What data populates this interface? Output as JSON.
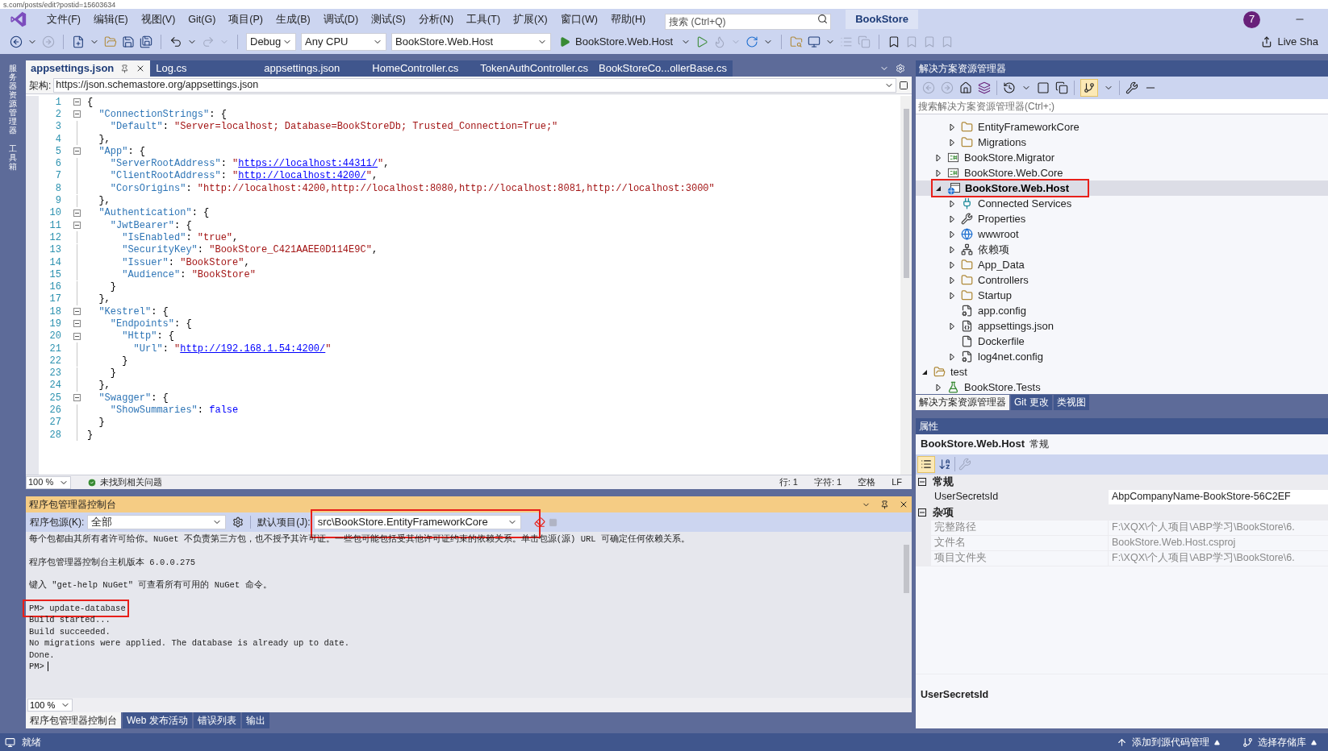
{
  "browser_url": "s.com/posts/edit?postid=15603634",
  "menu": [
    "文件(F)",
    "编辑(E)",
    "视图(V)",
    "Git(G)",
    "项目(P)",
    "生成(B)",
    "调试(D)",
    "测试(S)",
    "分析(N)",
    "工具(T)",
    "扩展(X)",
    "窗口(W)",
    "帮助(H)"
  ],
  "search": {
    "placeholder": "搜索 (Ctrl+Q)"
  },
  "solution_name": "BookStore",
  "account_badge": "7",
  "toolbar": {
    "configuration": "Debug",
    "platform": "Any CPU",
    "startup_project": "BookStore.Web.Host",
    "run_label": "BookStore.Web.Host",
    "live_share": "Live Sha"
  },
  "side_strip": [
    "服务器资源管理器",
    "工具箱"
  ],
  "doc_tabs": [
    {
      "label": "appsettings.json",
      "selected": true
    },
    {
      "label": "Log.cs",
      "selected": false
    },
    {
      "label": "appsettings.json",
      "selected": false
    },
    {
      "label": "HomeController.cs",
      "selected": false
    },
    {
      "label": "TokenAuthController.cs",
      "selected": false
    },
    {
      "label": "BookStoreCo...ollerBase.cs",
      "selected": false
    }
  ],
  "schema": {
    "label": "架构:",
    "value": "https://json.schemastore.org/appsettings.json"
  },
  "code_lines": [
    {
      "number": "1",
      "fold": true,
      "segments": [
        {
          "kind": "p",
          "text": "{"
        }
      ]
    },
    {
      "number": "2",
      "fold": true,
      "segments": [
        {
          "kind": "k",
          "text": "  \"ConnectionStrings\""
        },
        {
          "kind": "p",
          "text": ": {"
        }
      ]
    },
    {
      "number": "3",
      "fold": false,
      "segments": [
        {
          "kind": "k",
          "text": "    \"Default\""
        },
        {
          "kind": "p",
          "text": ": "
        },
        {
          "kind": "s",
          "text": "\"Server=localhost; Database=BookStoreDb; Trusted_Connection=True;\""
        }
      ]
    },
    {
      "number": "4",
      "fold": false,
      "segments": [
        {
          "kind": "p",
          "text": "  },"
        }
      ]
    },
    {
      "number": "5",
      "fold": true,
      "segments": [
        {
          "kind": "k",
          "text": "  \"App\""
        },
        {
          "kind": "p",
          "text": ": {"
        }
      ]
    },
    {
      "number": "6",
      "fold": false,
      "segments": [
        {
          "kind": "k",
          "text": "    \"ServerRootAddress\""
        },
        {
          "kind": "p",
          "text": ": "
        },
        {
          "kind": "s",
          "text": "\""
        },
        {
          "kind": "u",
          "text": "https://localhost:44311/"
        },
        {
          "kind": "s",
          "text": "\""
        },
        {
          "kind": "p",
          "text": ","
        }
      ]
    },
    {
      "number": "7",
      "fold": false,
      "segments": [
        {
          "kind": "k",
          "text": "    \"ClientRootAddress\""
        },
        {
          "kind": "p",
          "text": ": "
        },
        {
          "kind": "s",
          "text": "\""
        },
        {
          "kind": "u",
          "text": "http://localhost:4200/"
        },
        {
          "kind": "s",
          "text": "\""
        },
        {
          "kind": "p",
          "text": ","
        }
      ]
    },
    {
      "number": "8",
      "fold": false,
      "segments": [
        {
          "kind": "k",
          "text": "    \"CorsOrigins\""
        },
        {
          "kind": "p",
          "text": ": "
        },
        {
          "kind": "s",
          "text": "\"http://localhost:4200,http://localhost:8080,http://localhost:8081,http://localhost:3000\""
        }
      ]
    },
    {
      "number": "9",
      "fold": false,
      "segments": [
        {
          "kind": "p",
          "text": "  },"
        }
      ]
    },
    {
      "number": "10",
      "fold": true,
      "segments": [
        {
          "kind": "k",
          "text": "  \"Authentication\""
        },
        {
          "kind": "p",
          "text": ": {"
        }
      ]
    },
    {
      "number": "11",
      "fold": true,
      "segments": [
        {
          "kind": "k",
          "text": "    \"JwtBearer\""
        },
        {
          "kind": "p",
          "text": ": {"
        }
      ]
    },
    {
      "number": "12",
      "fold": false,
      "segments": [
        {
          "kind": "k",
          "text": "      \"IsEnabled\""
        },
        {
          "kind": "p",
          "text": ": "
        },
        {
          "kind": "s",
          "text": "\"true\""
        },
        {
          "kind": "p",
          "text": ","
        }
      ]
    },
    {
      "number": "13",
      "fold": false,
      "segments": [
        {
          "kind": "k",
          "text": "      \"SecurityKey\""
        },
        {
          "kind": "p",
          "text": ": "
        },
        {
          "kind": "s",
          "text": "\"BookStore_C421AAEE0D114E9C\""
        },
        {
          "kind": "p",
          "text": ","
        }
      ]
    },
    {
      "number": "14",
      "fold": false,
      "segments": [
        {
          "kind": "k",
          "text": "      \"Issuer\""
        },
        {
          "kind": "p",
          "text": ": "
        },
        {
          "kind": "s",
          "text": "\"BookStore\""
        },
        {
          "kind": "p",
          "text": ","
        }
      ]
    },
    {
      "number": "15",
      "fold": false,
      "segments": [
        {
          "kind": "k",
          "text": "      \"Audience\""
        },
        {
          "kind": "p",
          "text": ": "
        },
        {
          "kind": "s",
          "text": "\"BookStore\""
        }
      ]
    },
    {
      "number": "16",
      "fold": false,
      "segments": [
        {
          "kind": "p",
          "text": "    }"
        }
      ]
    },
    {
      "number": "17",
      "fold": false,
      "segments": [
        {
          "kind": "p",
          "text": "  },"
        }
      ]
    },
    {
      "number": "18",
      "fold": true,
      "segments": [
        {
          "kind": "k",
          "text": "  \"Kestrel\""
        },
        {
          "kind": "p",
          "text": ": {"
        }
      ]
    },
    {
      "number": "19",
      "fold": true,
      "segments": [
        {
          "kind": "k",
          "text": "    \"Endpoints\""
        },
        {
          "kind": "p",
          "text": ": {"
        }
      ]
    },
    {
      "number": "20",
      "fold": true,
      "segments": [
        {
          "kind": "k",
          "text": "      \"Http\""
        },
        {
          "kind": "p",
          "text": ": {"
        }
      ]
    },
    {
      "number": "21",
      "fold": false,
      "segments": [
        {
          "kind": "k",
          "text": "        \"Url\""
        },
        {
          "kind": "p",
          "text": ": "
        },
        {
          "kind": "s",
          "text": "\""
        },
        {
          "kind": "u",
          "text": "http://192.168.1.54:4200/"
        },
        {
          "kind": "s",
          "text": "\""
        }
      ]
    },
    {
      "number": "22",
      "fold": false,
      "segments": [
        {
          "kind": "p",
          "text": "      }"
        }
      ]
    },
    {
      "number": "23",
      "fold": false,
      "segments": [
        {
          "kind": "p",
          "text": "    }"
        }
      ]
    },
    {
      "number": "24",
      "fold": false,
      "segments": [
        {
          "kind": "p",
          "text": "  },"
        }
      ]
    },
    {
      "number": "25",
      "fold": true,
      "segments": [
        {
          "kind": "k",
          "text": "  \"Swagger\""
        },
        {
          "kind": "p",
          "text": ": {"
        }
      ]
    },
    {
      "number": "26",
      "fold": false,
      "segments": [
        {
          "kind": "k",
          "text": "    \"ShowSummaries\""
        },
        {
          "kind": "p",
          "text": ": "
        },
        {
          "kind": "b",
          "text": "false"
        }
      ]
    },
    {
      "number": "27",
      "fold": false,
      "segments": [
        {
          "kind": "p",
          "text": "  }"
        }
      ]
    },
    {
      "number": "28",
      "fold": false,
      "segments": [
        {
          "kind": "p",
          "text": "}"
        }
      ]
    }
  ],
  "editor_status": {
    "zoom": "100 %",
    "issues": "未找到相关问题",
    "line": "行: 1",
    "char": "字符: 1",
    "indent": "空格",
    "eol": "LF"
  },
  "console": {
    "title": "程序包管理器控制台",
    "source_label": "程序包源(K):",
    "source": "全部",
    "project_label": "默认项目(J):",
    "project": "src\\BookStore.EntityFrameworkCore",
    "project_annotated": true,
    "lines": [
      {
        "kind": "message",
        "text": "每个包都由其所有者许可给你。NuGet 不负责第三方包，也不授予其许可证。一些包可能包括受其他许可证约束的依赖关系。单击包源(源) URL 可确定任何依赖关系。",
        "annotated": false
      },
      {
        "kind": "message",
        "text": "程序包管理器控制台主机版本 6.0.0.275",
        "annotated": false
      },
      {
        "kind": "message",
        "text": "键入 \"get-help NuGet\" 可查看所有可用的 NuGet 命令。",
        "annotated": false
      },
      {
        "kind": "command",
        "text": "PM> update-database",
        "annotated": true
      },
      {
        "kind": "output",
        "text": "Build started...",
        "annotated": false
      },
      {
        "kind": "output",
        "text": "Build succeeded.",
        "annotated": false
      },
      {
        "kind": "output",
        "text": "No migrations were applied. The database is already up to date.",
        "annotated": false
      },
      {
        "kind": "output",
        "text": "Done.",
        "annotated": false
      },
      {
        "kind": "prompt",
        "text": "PM>",
        "annotated": false
      }
    ],
    "zoom": "100 %"
  },
  "bottom_tabs": [
    {
      "label": "程序包管理器控制台",
      "selected": true
    },
    {
      "label": "Web 发布活动",
      "selected": false
    },
    {
      "label": "错误列表",
      "selected": false
    },
    {
      "label": "输出",
      "selected": false
    }
  ],
  "solution_explorer": {
    "title": "解决方案资源管理器",
    "search_placeholder": "搜索解决方案资源管理器(Ctrl+;)",
    "tree": [
      {
        "children": [
          {
            "children": [
              {
                "label": "EntityFrameworkCore",
                "kind": "folder",
                "expanded": false,
                "selected": false
              },
              {
                "label": "Migrations",
                "kind": "folder",
                "expanded": false,
                "selected": false
              }
            ]
          },
          {
            "label": "BookStore.Migrator",
            "kind": "csharp",
            "expanded": false,
            "selected": false
          },
          {
            "label": "BookStore.Web.Core",
            "kind": "csharp",
            "expanded": false,
            "selected": false
          },
          {
            "label": "BookStore.Web.Host",
            "kind": "web_project",
            "expanded": true,
            "selected": true,
            "annotated": true,
            "children": [
              {
                "label": "Connected Services",
                "kind": "connected",
                "expanded": false,
                "selected": false
              },
              {
                "label": "Properties",
                "kind": "properties",
                "expanded": false,
                "selected": false
              },
              {
                "label": "wwwroot",
                "kind": "globe",
                "expanded": false,
                "selected": false
              },
              {
                "label": "依赖项",
                "kind": "dependencies",
                "expanded": false,
                "selected": false
              },
              {
                "label": "App_Data",
                "kind": "folder",
                "expanded": false,
                "selected": false
              },
              {
                "label": "Controllers",
                "kind": "folder",
                "expanded": false,
                "selected": false
              },
              {
                "label": "Startup",
                "kind": "folder",
                "expanded": false,
                "selected": false
              },
              {
                "label": "app.config",
                "kind": "config",
                "selected": false
              },
              {
                "label": "appsettings.json",
                "kind": "json",
                "expanded": false,
                "selected": false
              },
              {
                "label": "Dockerfile",
                "kind": "file",
                "selected": false
              },
              {
                "label": "log4net.config",
                "kind": "config",
                "expanded": false,
                "selected": false
              }
            ]
          }
        ]
      },
      {
        "label": "test",
        "kind": "folder_open",
        "expanded": true,
        "selected": false,
        "children": [
          {
            "label": "BookStore.Tests",
            "kind": "test_project",
            "expanded": false,
            "selected": false
          }
        ]
      }
    ],
    "tabs": [
      {
        "label": "解决方案资源管理器",
        "selected": true
      },
      {
        "label": "Git 更改",
        "selected": false
      },
      {
        "label": "类视图",
        "selected": false
      }
    ]
  },
  "properties": {
    "title": "属性",
    "object": "BookStore.Web.Host",
    "object_type": "常规",
    "categories": [
      {
        "name": "常规",
        "expanded": true,
        "rows": [
          {
            "name": "UserSecretsId",
            "value": "AbpCompanyName-BookStore-56C2EF",
            "disabled": false
          }
        ]
      },
      {
        "name": "杂项",
        "expanded": true,
        "rows": [
          {
            "name": "完整路径",
            "value": "F:\\XQX\\个人项目\\ABP学习\\BookStore\\6.",
            "disabled": true
          },
          {
            "name": "文件名",
            "value": "BookStore.Web.Host.csproj",
            "disabled": true
          },
          {
            "name": "项目文件夹",
            "value": "F:\\XQX\\个人项目\\ABP学习\\BookStore\\6.",
            "disabled": true
          }
        ]
      }
    ],
    "description": "UserSecretsId"
  },
  "status_bar": {
    "ready": "就绪",
    "add_source": "添加到源代码管理",
    "repo": "选择存储库"
  }
}
